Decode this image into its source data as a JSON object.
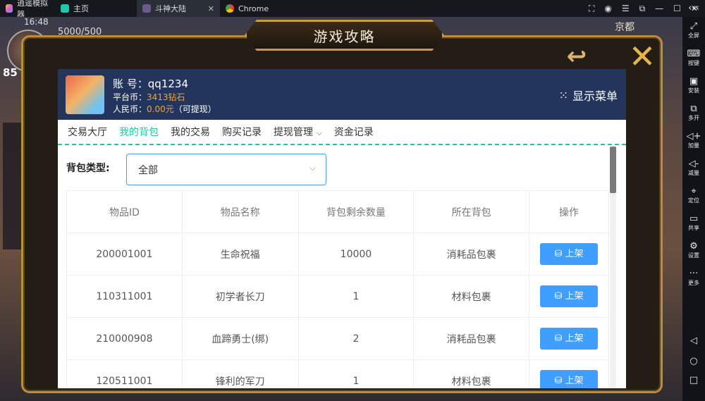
{
  "taskbar": {
    "tabs": [
      {
        "label": "逍遥模拟器"
      },
      {
        "label": "主页"
      },
      {
        "label": "斗神大陆"
      },
      {
        "label": "Chrome"
      }
    ]
  },
  "game": {
    "hud_time": "16:48",
    "gold": "5000/500",
    "city": "京都",
    "level": "85"
  },
  "emulator_sidebar": [
    {
      "label": "全屏",
      "icon": "fullscreen-icon"
    },
    {
      "label": "按键",
      "icon": "keyboard-icon"
    },
    {
      "label": "安装",
      "icon": "apk-icon"
    },
    {
      "label": "多开",
      "icon": "multi-instance-icon"
    },
    {
      "label": "加量",
      "icon": "volume-up-icon"
    },
    {
      "label": "减量",
      "icon": "volume-down-icon"
    },
    {
      "label": "定位",
      "icon": "location-icon"
    },
    {
      "label": "共享",
      "icon": "folder-icon"
    },
    {
      "label": "设置",
      "icon": "gear-icon"
    },
    {
      "label": "更多",
      "icon": "more-icon"
    }
  ],
  "modal": {
    "title": "游戏攻略"
  },
  "account": {
    "account_label": "账 号：",
    "account_value": "qq1234",
    "platform_label": "平台币：",
    "platform_value": "3413钻石",
    "rmb_label": "人民币：",
    "rmb_value": "0.00元",
    "rmb_note": "（可提现）",
    "menu_label": "显示菜单"
  },
  "nav": [
    {
      "label": "交易大厅"
    },
    {
      "label": "我的背包",
      "active": true
    },
    {
      "label": "我的交易"
    },
    {
      "label": "购买记录"
    },
    {
      "label": "提现管理"
    },
    {
      "label": "资金记录"
    }
  ],
  "filter": {
    "label": "背包类型:",
    "value": "全部"
  },
  "table": {
    "headers": [
      "物品ID",
      "物品名称",
      "背包剩余数量",
      "所在背包",
      "操作"
    ],
    "rows": [
      {
        "id": "200001001",
        "name": "生命祝福",
        "qty": "10000",
        "bag": "消耗品包裹",
        "action": "上架"
      },
      {
        "id": "110311001",
        "name": "初学者长刀",
        "qty": "1",
        "bag": "材料包裹",
        "action": "上架"
      },
      {
        "id": "210000908",
        "name": "血蹄勇士(绑)",
        "qty": "2",
        "bag": "消耗品包裹",
        "action": "上架"
      },
      {
        "id": "120511001",
        "name": "锋利的军刀",
        "qty": "1",
        "bag": "材料包裹",
        "action": "上架"
      }
    ]
  }
}
